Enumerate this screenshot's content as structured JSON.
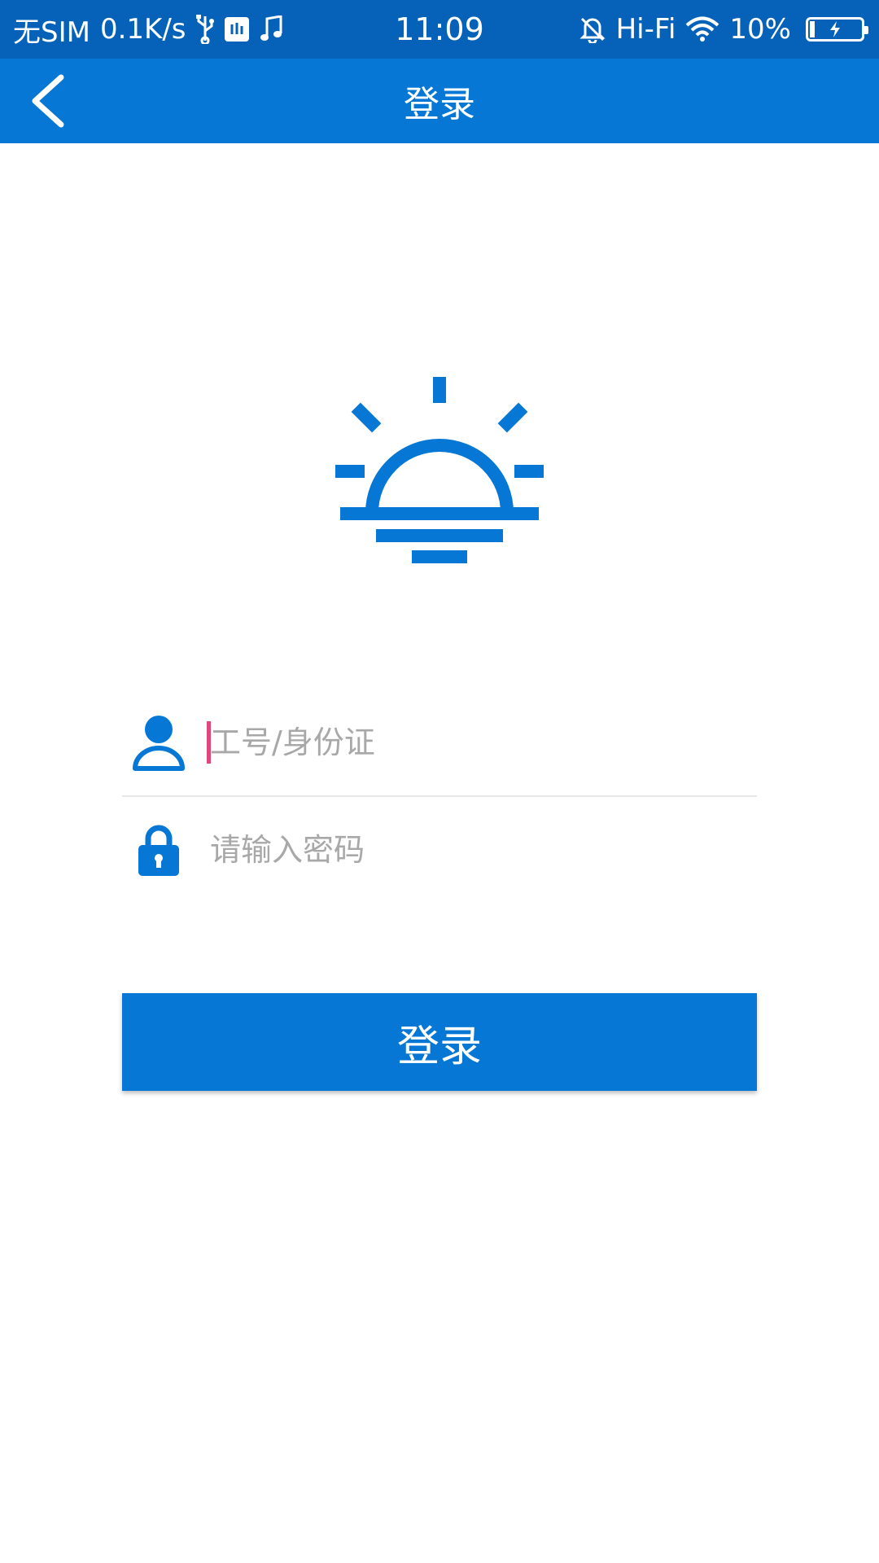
{
  "status_bar": {
    "carrier": "无SIM",
    "network_speed": "0.1K/s",
    "time": "11:09",
    "hifi_label": "Hi-Fi",
    "battery_percent": "10%",
    "battery_level": 0.1,
    "icons": [
      "usb-icon",
      "usb-debug-icon",
      "music-note-icon",
      "bell-muted-icon",
      "wifi-icon",
      "battery-charging-icon"
    ]
  },
  "app_bar": {
    "title": "登录",
    "back_icon": "chevron-left-icon"
  },
  "logo": {
    "icon": "sunrise-icon",
    "color": "#0677d4"
  },
  "form": {
    "username": {
      "placeholder": "工号/身份证",
      "value": "",
      "icon": "user-icon"
    },
    "password": {
      "placeholder": "请输入密码",
      "value": "",
      "icon": "lock-icon"
    }
  },
  "login_button": {
    "label": "登录"
  },
  "colors": {
    "status_bar": "#0662b8",
    "app_bar": "#0677d4",
    "accent": "#0677d4",
    "caret": "#e0457b",
    "placeholder": "#a8a8a8"
  }
}
